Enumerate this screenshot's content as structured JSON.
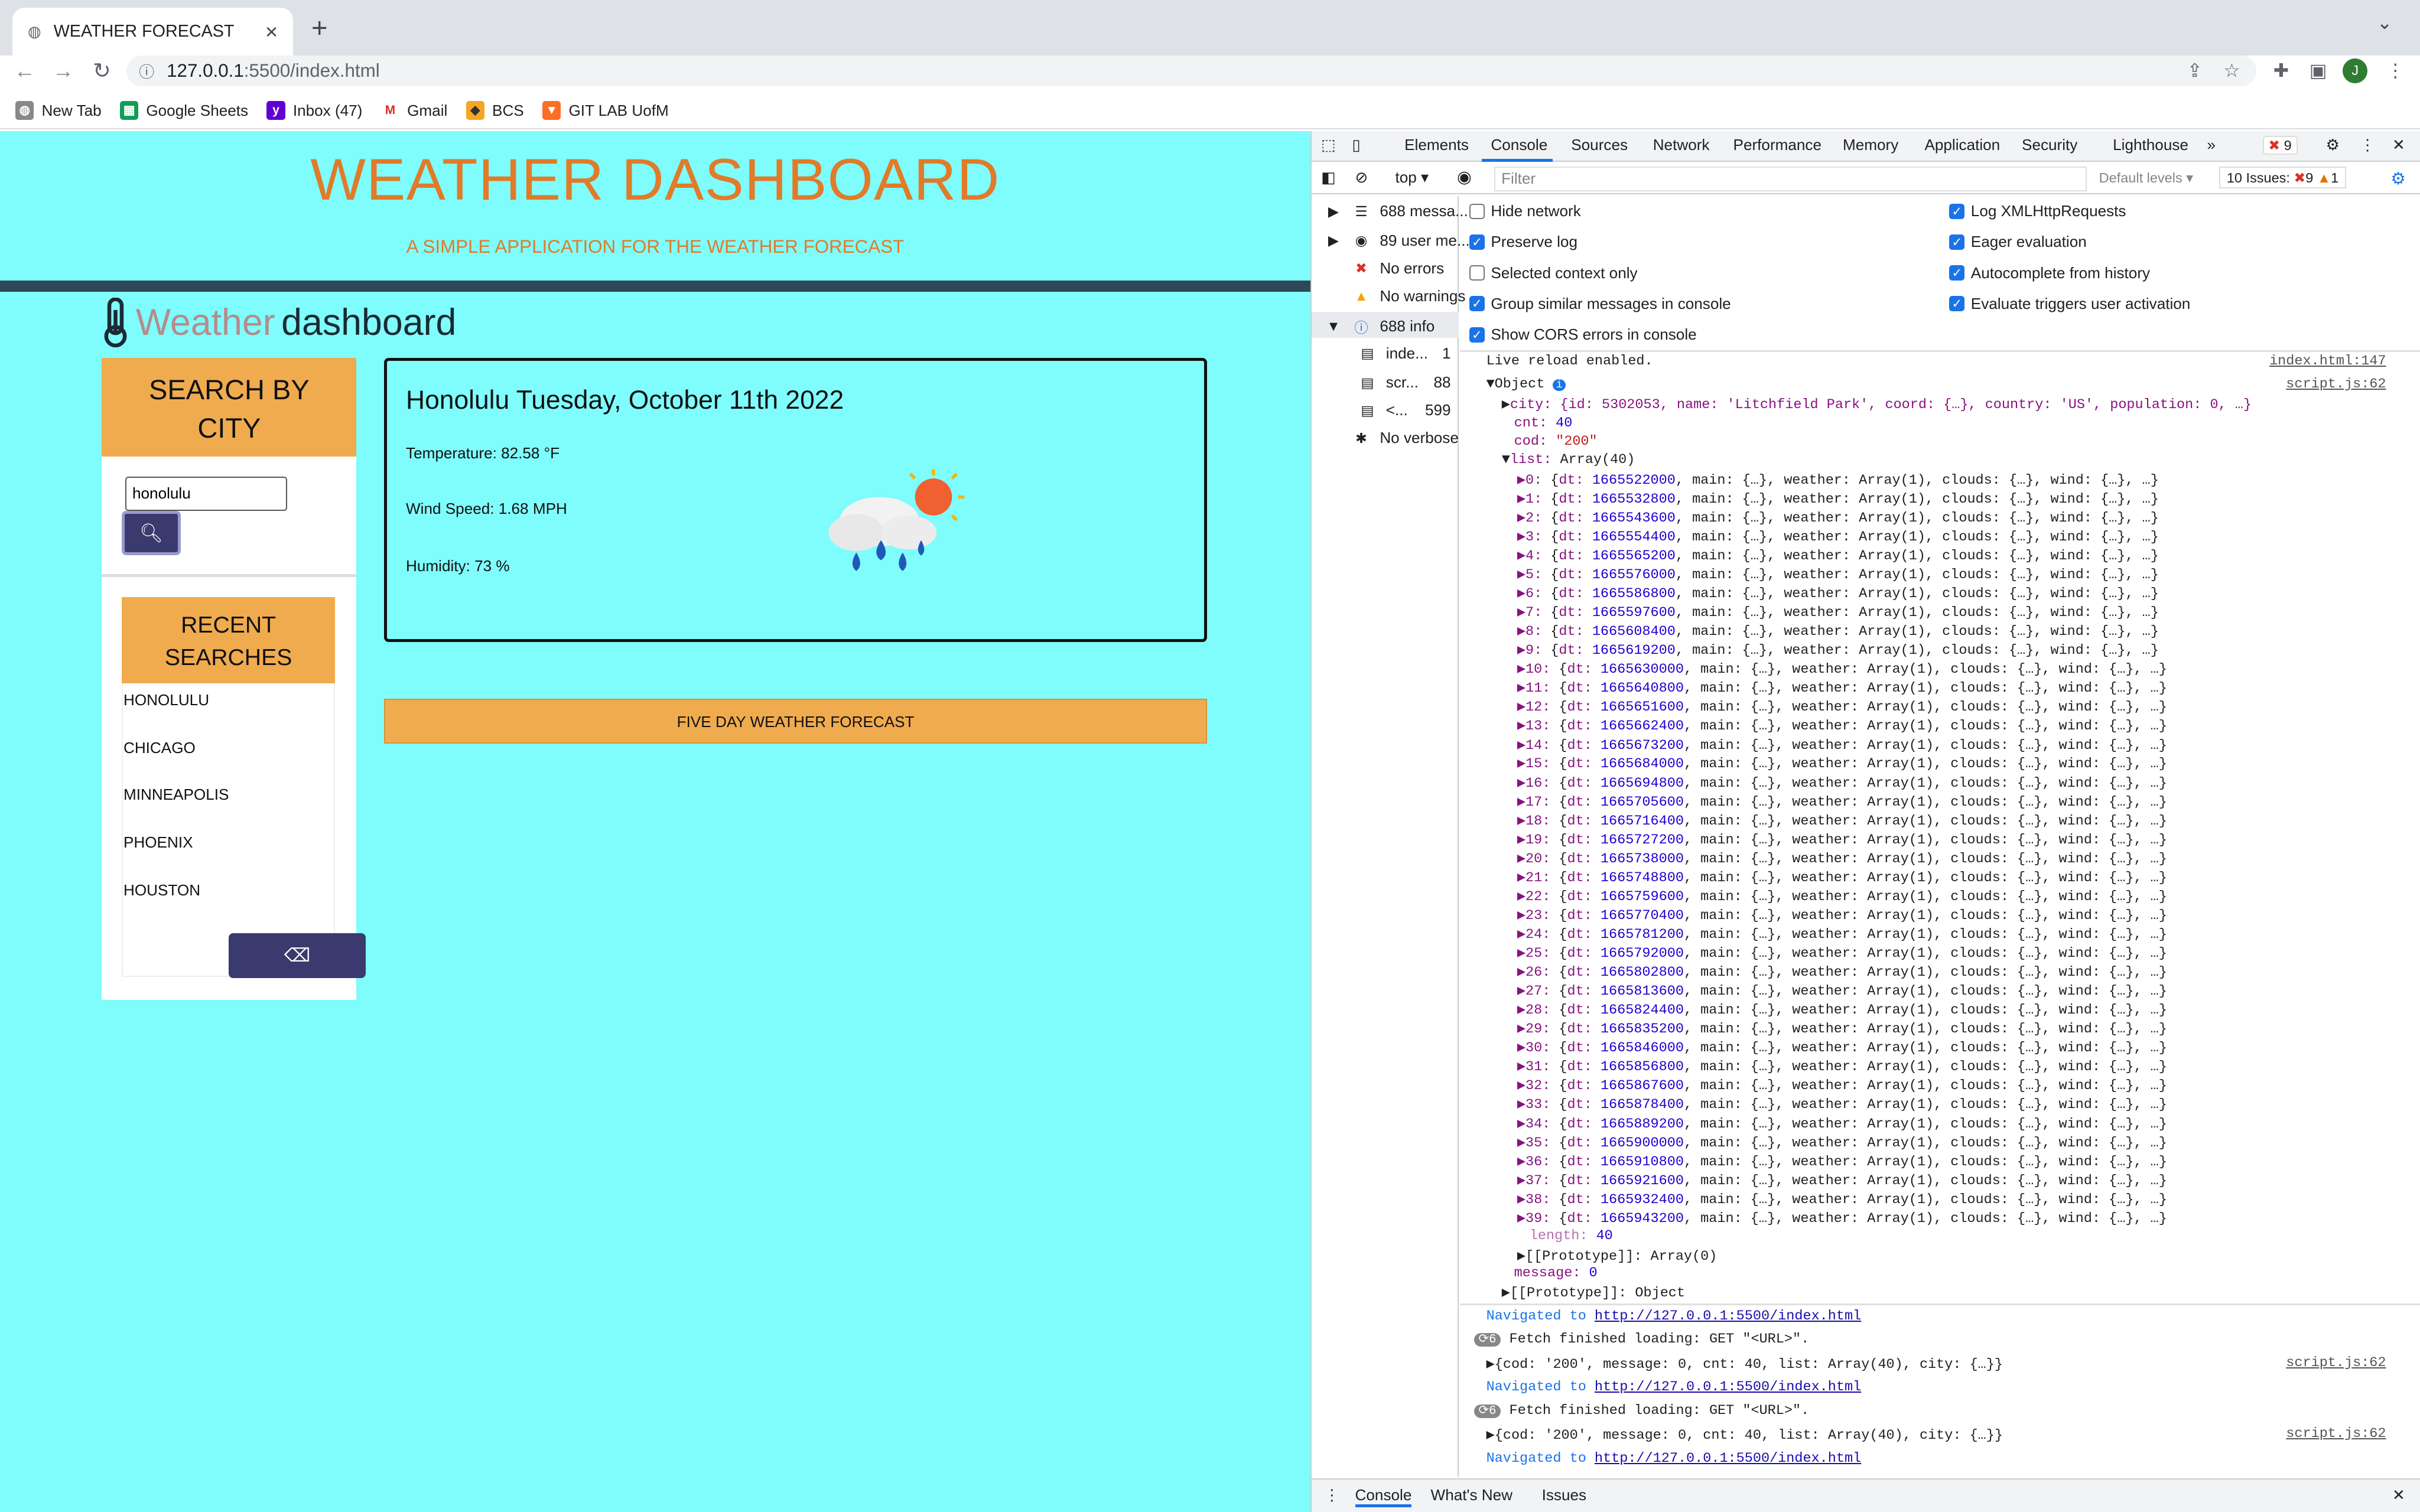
{
  "browser": {
    "tab_title": "WEATHER FORECAST",
    "url_host": "127.0.0.1",
    "url_path": ":5500/index.html",
    "avatar": "J",
    "bookmarks": [
      "New Tab",
      "Google Sheets",
      "Inbox (47)",
      "Gmail",
      "BCS",
      "GIT LAB UofM"
    ]
  },
  "page": {
    "title": "WEATHER DASHBOARD",
    "subtitle": "A SIMPLE APPLICATION FOR THE WEATHER FORECAST",
    "brand_weather": "Weather",
    "brand_dashboard": "dashboard",
    "search_heading_1": "SEARCH BY",
    "search_heading_2": "CITY",
    "search_value": "honolulu",
    "recent_heading_1": "RECENT",
    "recent_heading_2": "SEARCHES",
    "recent": [
      "HONOLULU",
      "CHICAGO",
      "MINNEAPOLIS",
      "PHOENIX",
      "HOUSTON"
    ],
    "current_title": "Honolulu Tuesday, October 11th 2022",
    "temperature": "Temperature: 82.58 °F",
    "wind": "Wind Speed: 1.68 MPH",
    "humidity": "Humidity: 73 %",
    "five_day": "FIVE DAY WEATHER FORECAST"
  },
  "devtools": {
    "tabs": [
      "Elements",
      "Console",
      "Sources",
      "Network",
      "Performance",
      "Memory",
      "Application",
      "Security",
      "Lighthouse"
    ],
    "error_count": "9",
    "context": "top",
    "filter_placeholder": "Filter",
    "levels": "Default levels",
    "issues_label": "10 Issues:",
    "issues_err": "9",
    "issues_warn": "1",
    "sidebar": [
      {
        "label": "688 messa...",
        "icon": "list-icon"
      },
      {
        "label": "89 user me...",
        "icon": "user-icon"
      },
      {
        "label": "No errors",
        "icon": "error-icon"
      },
      {
        "label": "No warnings",
        "icon": "warning-icon"
      },
      {
        "label": "688 info",
        "icon": "info-icon"
      },
      {
        "label": "inde...",
        "count": "1"
      },
      {
        "label": "scr...",
        "count": "88"
      },
      {
        "label": "<...",
        "count": "599"
      },
      {
        "label": "No verbose",
        "icon": "bug-icon"
      }
    ],
    "settings_left": [
      {
        "label": "Hide network",
        "checked": false
      },
      {
        "label": "Preserve log",
        "checked": true
      },
      {
        "label": "Selected context only",
        "checked": false
      },
      {
        "label": "Group similar messages in console",
        "checked": true
      },
      {
        "label": "Show CORS errors in console",
        "checked": true
      }
    ],
    "settings_right": [
      {
        "label": "Log XMLHttpRequests",
        "checked": true
      },
      {
        "label": "Eager evaluation",
        "checked": true
      },
      {
        "label": "Autocomplete from history",
        "checked": true
      },
      {
        "label": "Evaluate triggers user activation",
        "checked": true
      }
    ],
    "live_reload": "Live reload enabled.",
    "live_reload_src": "index.html:147",
    "object_src": "script.js:62",
    "city_line": "city: {id: 5302053, name: 'Litchfield Park', coord: {…}, country: 'US', population: 0, …}",
    "cnt": "40",
    "cod": "\"200\"",
    "list_dt": [
      "1665522000",
      "1665532800",
      "1665543600",
      "1665554400",
      "1665565200",
      "1665576000",
      "1665586800",
      "1665597600",
      "1665608400",
      "1665619200",
      "1665630000",
      "1665640800",
      "1665651600",
      "1665662400",
      "1665673200",
      "1665684000",
      "1665694800",
      "1665705600",
      "1665716400",
      "1665727200",
      "1665738000",
      "1665748800",
      "1665759600",
      "1665770400",
      "1665781200",
      "1665792000",
      "1665802800",
      "1665813600",
      "1665824400",
      "1665835200",
      "1665846000",
      "1665856800",
      "1665867600",
      "1665878400",
      "1665889200",
      "1665900000",
      "1665910800",
      "1665921600",
      "1665932400",
      "1665943200"
    ],
    "nav_text": "Navigated to",
    "nav_url": "http://127.0.0.1:5500/index.html",
    "fetch_text": "Fetch finished loading: GET \"<URL>\".",
    "fetch_count": "6",
    "obj_summary": "{cod: '200', message: 0, cnt: 40, list: Array(40), city: {…}}",
    "drawer_tabs": [
      "Console",
      "What's New",
      "Issues"
    ]
  }
}
